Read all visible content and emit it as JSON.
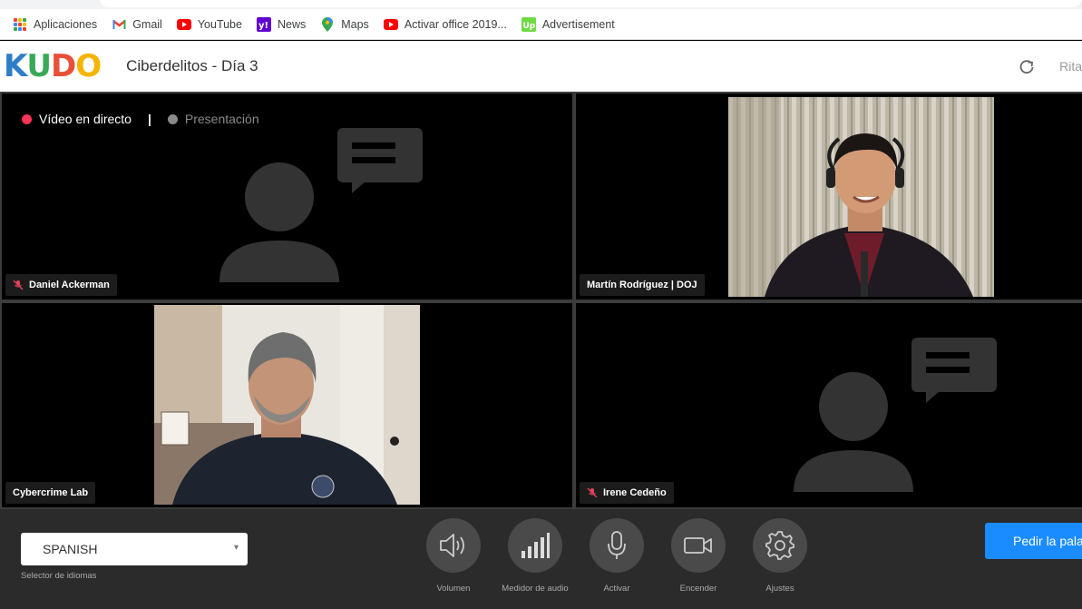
{
  "bookmarks": [
    {
      "label": "Aplicaciones",
      "icon": "apps-grid-icon"
    },
    {
      "label": "Gmail",
      "icon": "gmail-icon"
    },
    {
      "label": "YouTube",
      "icon": "youtube-icon"
    },
    {
      "label": "News",
      "icon": "yahoo-icon"
    },
    {
      "label": "Maps",
      "icon": "maps-pin-icon"
    },
    {
      "label": "Activar office 2019...",
      "icon": "youtube-icon"
    },
    {
      "label": "Advertisement",
      "icon": "upwork-icon"
    }
  ],
  "header": {
    "logo_letters": [
      "K",
      "U",
      "D",
      "O"
    ],
    "logo_colors": [
      "#2e7dc8",
      "#3aa858",
      "#e8503a",
      "#f4b400"
    ],
    "session_title": "Ciberdelitos - Día 3",
    "user_name": "Rita"
  },
  "stage": {
    "live_label": "Vídeo en directo",
    "separator": "|",
    "presentation_label": "Presentación",
    "live_color": "#ff3355",
    "presentation_color": "#8a8a8a"
  },
  "participants": [
    {
      "name": "Daniel Ackerman",
      "muted": true,
      "video": false
    },
    {
      "name": "Martín Rodríguez | DOJ",
      "muted": false,
      "video": true
    },
    {
      "name": "Cybercrime Lab",
      "muted": false,
      "video": true
    },
    {
      "name": "Irene Cedeño",
      "muted": true,
      "video": false
    }
  ],
  "controls": {
    "language_value": "SPANISH",
    "language_caption": "Selector de idiomas",
    "buttons": [
      {
        "label": "Volumen",
        "icon": "speaker-icon"
      },
      {
        "label": "Medidor de audio",
        "icon": "signal-bars-icon"
      },
      {
        "label": "Activar",
        "icon": "microphone-icon"
      },
      {
        "label": "Encender",
        "icon": "camera-icon"
      },
      {
        "label": "Ajustes",
        "icon": "gear-icon"
      }
    ],
    "floor_button": "Pedir la pala"
  },
  "colors": {
    "accent": "#1a8cff",
    "muted_icon": "#e0435a"
  }
}
